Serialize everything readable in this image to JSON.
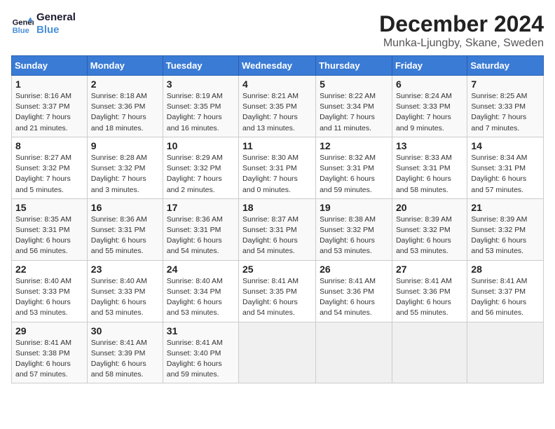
{
  "logo": {
    "text_general": "General",
    "text_blue": "Blue"
  },
  "title": "December 2024",
  "subtitle": "Munka-Ljungby, Skane, Sweden",
  "days_of_week": [
    "Sunday",
    "Monday",
    "Tuesday",
    "Wednesday",
    "Thursday",
    "Friday",
    "Saturday"
  ],
  "weeks": [
    [
      {
        "day": "1",
        "sunrise": "8:16 AM",
        "sunset": "3:37 PM",
        "daylight_hours": "7 hours",
        "daylight_min": "21 minutes."
      },
      {
        "day": "2",
        "sunrise": "8:18 AM",
        "sunset": "3:36 PM",
        "daylight_hours": "7 hours",
        "daylight_min": "18 minutes."
      },
      {
        "day": "3",
        "sunrise": "8:19 AM",
        "sunset": "3:35 PM",
        "daylight_hours": "7 hours",
        "daylight_min": "16 minutes."
      },
      {
        "day": "4",
        "sunrise": "8:21 AM",
        "sunset": "3:35 PM",
        "daylight_hours": "7 hours",
        "daylight_min": "13 minutes."
      },
      {
        "day": "5",
        "sunrise": "8:22 AM",
        "sunset": "3:34 PM",
        "daylight_hours": "7 hours",
        "daylight_min": "11 minutes."
      },
      {
        "day": "6",
        "sunrise": "8:24 AM",
        "sunset": "3:33 PM",
        "daylight_hours": "7 hours",
        "daylight_min": "9 minutes."
      },
      {
        "day": "7",
        "sunrise": "8:25 AM",
        "sunset": "3:33 PM",
        "daylight_hours": "7 hours",
        "daylight_min": "7 minutes."
      }
    ],
    [
      {
        "day": "8",
        "sunrise": "8:27 AM",
        "sunset": "3:32 PM",
        "daylight_hours": "7 hours",
        "daylight_min": "5 minutes."
      },
      {
        "day": "9",
        "sunrise": "8:28 AM",
        "sunset": "3:32 PM",
        "daylight_hours": "7 hours",
        "daylight_min": "3 minutes."
      },
      {
        "day": "10",
        "sunrise": "8:29 AM",
        "sunset": "3:32 PM",
        "daylight_hours": "7 hours",
        "daylight_min": "2 minutes."
      },
      {
        "day": "11",
        "sunrise": "8:30 AM",
        "sunset": "3:31 PM",
        "daylight_hours": "7 hours",
        "daylight_min": "0 minutes."
      },
      {
        "day": "12",
        "sunrise": "8:32 AM",
        "sunset": "3:31 PM",
        "daylight_hours": "6 hours",
        "daylight_min": "59 minutes."
      },
      {
        "day": "13",
        "sunrise": "8:33 AM",
        "sunset": "3:31 PM",
        "daylight_hours": "6 hours",
        "daylight_min": "58 minutes."
      },
      {
        "day": "14",
        "sunrise": "8:34 AM",
        "sunset": "3:31 PM",
        "daylight_hours": "6 hours",
        "daylight_min": "57 minutes."
      }
    ],
    [
      {
        "day": "15",
        "sunrise": "8:35 AM",
        "sunset": "3:31 PM",
        "daylight_hours": "6 hours",
        "daylight_min": "56 minutes."
      },
      {
        "day": "16",
        "sunrise": "8:36 AM",
        "sunset": "3:31 PM",
        "daylight_hours": "6 hours",
        "daylight_min": "55 minutes."
      },
      {
        "day": "17",
        "sunrise": "8:36 AM",
        "sunset": "3:31 PM",
        "daylight_hours": "6 hours",
        "daylight_min": "54 minutes."
      },
      {
        "day": "18",
        "sunrise": "8:37 AM",
        "sunset": "3:31 PM",
        "daylight_hours": "6 hours",
        "daylight_min": "54 minutes."
      },
      {
        "day": "19",
        "sunrise": "8:38 AM",
        "sunset": "3:32 PM",
        "daylight_hours": "6 hours",
        "daylight_min": "53 minutes."
      },
      {
        "day": "20",
        "sunrise": "8:39 AM",
        "sunset": "3:32 PM",
        "daylight_hours": "6 hours",
        "daylight_min": "53 minutes."
      },
      {
        "day": "21",
        "sunrise": "8:39 AM",
        "sunset": "3:32 PM",
        "daylight_hours": "6 hours",
        "daylight_min": "53 minutes."
      }
    ],
    [
      {
        "day": "22",
        "sunrise": "8:40 AM",
        "sunset": "3:33 PM",
        "daylight_hours": "6 hours",
        "daylight_min": "53 minutes."
      },
      {
        "day": "23",
        "sunrise": "8:40 AM",
        "sunset": "3:33 PM",
        "daylight_hours": "6 hours",
        "daylight_min": "53 minutes."
      },
      {
        "day": "24",
        "sunrise": "8:40 AM",
        "sunset": "3:34 PM",
        "daylight_hours": "6 hours",
        "daylight_min": "53 minutes."
      },
      {
        "day": "25",
        "sunrise": "8:41 AM",
        "sunset": "3:35 PM",
        "daylight_hours": "6 hours",
        "daylight_min": "54 minutes."
      },
      {
        "day": "26",
        "sunrise": "8:41 AM",
        "sunset": "3:36 PM",
        "daylight_hours": "6 hours",
        "daylight_min": "54 minutes."
      },
      {
        "day": "27",
        "sunrise": "8:41 AM",
        "sunset": "3:36 PM",
        "daylight_hours": "6 hours",
        "daylight_min": "55 minutes."
      },
      {
        "day": "28",
        "sunrise": "8:41 AM",
        "sunset": "3:37 PM",
        "daylight_hours": "6 hours",
        "daylight_min": "56 minutes."
      }
    ],
    [
      {
        "day": "29",
        "sunrise": "8:41 AM",
        "sunset": "3:38 PM",
        "daylight_hours": "6 hours",
        "daylight_min": "57 minutes."
      },
      {
        "day": "30",
        "sunrise": "8:41 AM",
        "sunset": "3:39 PM",
        "daylight_hours": "6 hours",
        "daylight_min": "58 minutes."
      },
      {
        "day": "31",
        "sunrise": "8:41 AM",
        "sunset": "3:40 PM",
        "daylight_hours": "6 hours",
        "daylight_min": "59 minutes."
      },
      null,
      null,
      null,
      null
    ]
  ],
  "labels": {
    "sunrise": "Sunrise:",
    "sunset": "Sunset:",
    "daylight": "Daylight:"
  }
}
